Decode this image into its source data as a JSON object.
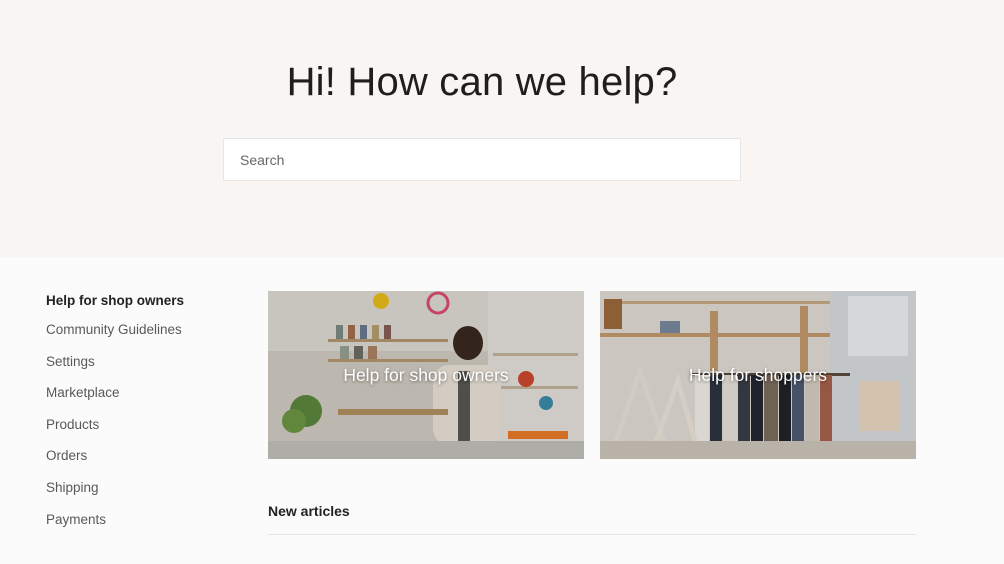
{
  "hero": {
    "title": "Hi! How can we help?",
    "search_placeholder": "Search"
  },
  "sidebar": {
    "heading": "Help for shop owners",
    "items": [
      {
        "label": "Community Guidelines"
      },
      {
        "label": "Settings"
      },
      {
        "label": "Marketplace"
      },
      {
        "label": "Products"
      },
      {
        "label": "Orders"
      },
      {
        "label": "Shipping"
      },
      {
        "label": "Payments"
      }
    ]
  },
  "cards": [
    {
      "label": "Help for shop owners"
    },
    {
      "label": "Help for shoppers"
    }
  ],
  "articles": {
    "heading": "New articles"
  }
}
